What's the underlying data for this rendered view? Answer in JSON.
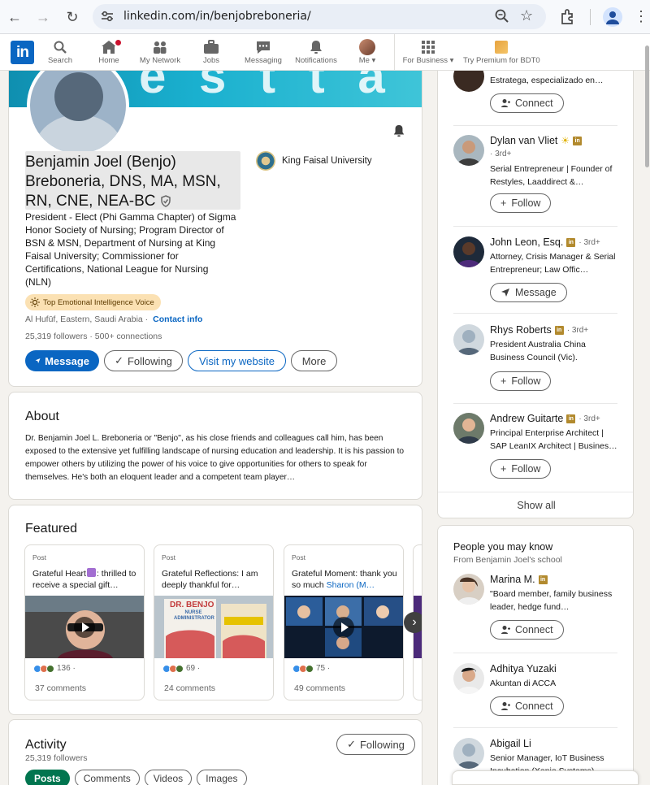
{
  "browser": {
    "url": "linkedin.com/in/benjobreboneria/"
  },
  "nav": {
    "logo": "in",
    "items": [
      {
        "label": "Search"
      },
      {
        "label": "Home"
      },
      {
        "label": "My Network"
      },
      {
        "label": "Jobs"
      },
      {
        "label": "Messaging"
      },
      {
        "label": "Notifications"
      },
      {
        "label": "Me"
      },
      {
        "label": "For Business"
      },
      {
        "label": "Try Premium for BDT0"
      }
    ]
  },
  "profile": {
    "banner_text": "e s t t a",
    "name": "Benjamin Joel (Benjo) Breboneria, DNS, MA, MSN, RN, CNE, NEA-BC",
    "university": "King Faisal University",
    "headline": "President - Elect (Phi Gamma Chapter) of Sigma Honor Society of Nursing; Program Director of BSN & MSN, Department of Nursing at King Faisal University; Commissioner for Certifications, National League for Nursing (NLN)",
    "badge": "Top Emotional Intelligence Voice",
    "location": "Al Hufūf, Eastern, Saudi Arabia ·",
    "contact_info": "Contact info",
    "followers": "25,319 followers · 500+ connections",
    "actions": {
      "message": "Message",
      "following": "Following",
      "website": "Visit my website",
      "more": "More"
    }
  },
  "about": {
    "title": "About",
    "text": "Dr. Benjamin Joel L. Breboneria or \"Benjo\", as his close friends and colleagues call him, has been exposed to the extensive yet fulfilling landscape of nursing education and leadership. It is his passion to empower others by utilizing the power of his voice to give opportunities for others to speak for themselves. He's both an eloquent leader and a competent team player…"
  },
  "featured": {
    "title": "Featured",
    "items": [
      {
        "kind": "Post",
        "title_a": "Grateful Heart",
        "title_b": ": thrilled to receive a special gift…",
        "reactions": "136 ·",
        "comments": "37 comments"
      },
      {
        "kind": "Post",
        "title": "Grateful Reflections: I am deeply thankful for…",
        "reactions": "69 ·",
        "comments": "24 comments",
        "thumb_text_1": "DR. BENJO",
        "thumb_text_2": "NURSE ADMINISTRATOR"
      },
      {
        "kind": "Post",
        "title_a": "Grateful Moment: thank you so much ",
        "mention": "Sharon (M…",
        "reactions": "75 ·",
        "comments": "49 comments"
      }
    ]
  },
  "activity": {
    "title": "Activity",
    "followers": "25,319 followers",
    "following_button": "Following",
    "tabs": [
      "Posts",
      "Comments",
      "Videos",
      "Images"
    ]
  },
  "sidebar": {
    "top_partial_desc": "Estratega, especializado en…",
    "top_partial_button": "Connect",
    "people": [
      {
        "name": "Dylan van Vliet",
        "degree": "· 3rd+",
        "desc": "Serial Entrepreneur | Founder of Restyles, Laaddirect &…",
        "button": "Follow"
      },
      {
        "name": "John Leon, Esq.",
        "degree": "· 3rd+",
        "desc": "Attorney, Crisis Manager & Serial Entrepreneur; Law Offic…",
        "button": "Message"
      },
      {
        "name": "Rhys Roberts",
        "degree": "· 3rd+",
        "desc": "President Australia China Business Council (Vic).",
        "button": "Follow"
      },
      {
        "name": "Andrew Guitarte",
        "degree": "· 3rd+",
        "desc": "Principal Enterprise Architect | SAP LeanIX Architect | Busines…",
        "button": "Follow"
      }
    ],
    "show_all": "Show all",
    "pymk": {
      "title": "People you may know",
      "subtitle": "From Benjamin Joel's school",
      "people": [
        {
          "name": "Marina M.",
          "desc": "\"Board member, family business leader, hedge fund…",
          "button": "Connect"
        },
        {
          "name": "Adhitya Yuzaki",
          "desc": "Akuntan di ACCA",
          "button": "Connect"
        },
        {
          "name": "Abigail Li",
          "desc": "Senior Manager, IoT Business Incubation (Xenio Systems)"
        }
      ]
    }
  },
  "colors": {
    "linkedin_blue": "#0a66c2",
    "premium_gold": "#b28a2e",
    "posts_green": "#01754f"
  }
}
